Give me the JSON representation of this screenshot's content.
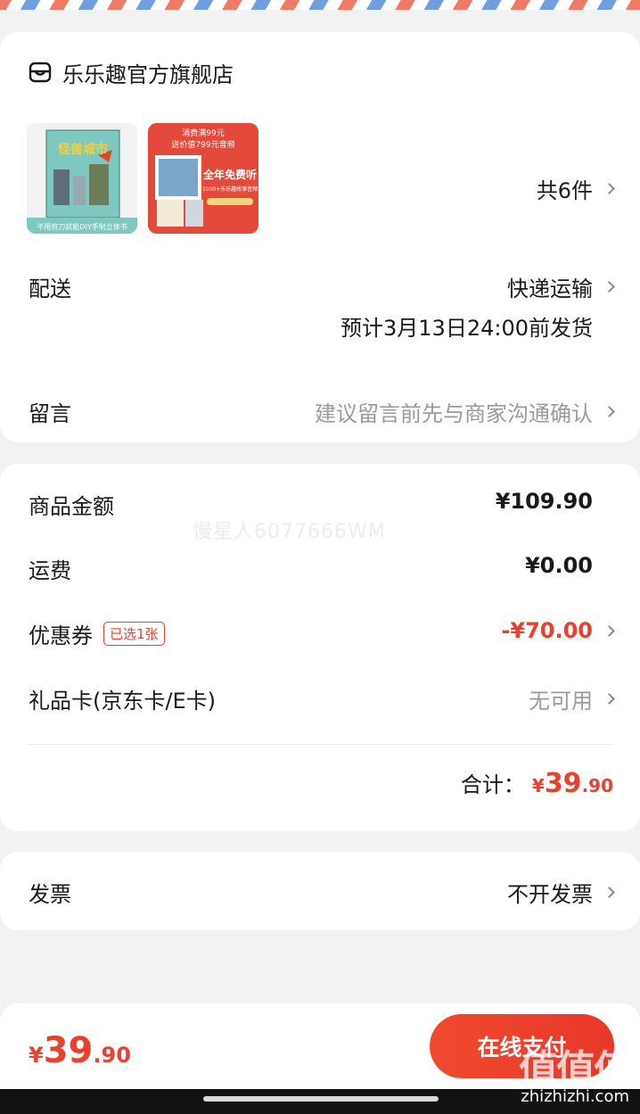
{
  "store": {
    "name": "乐乐趣官方旗舰店",
    "icon": "store-icon"
  },
  "products": {
    "item1": {
      "title": "怪兽城市",
      "caption": "不用剪刀就能DIY手制立体书"
    },
    "item2": {
      "line1": "消费满99元",
      "line2": "送价值799元音频",
      "headline": "全年免费听",
      "sub": "1000+乐乐趣故事音频"
    },
    "count_label": "共6件"
  },
  "delivery": {
    "label": "配送",
    "method": "快递运输",
    "eta": "预计3月13日24:00前发货"
  },
  "message": {
    "label": "留言",
    "placeholder": "建议留言前先与商家沟通确认"
  },
  "pricing": {
    "goods_label": "商品金额",
    "goods_value": "¥109.90",
    "shipping_label": "运费",
    "shipping_value": "¥0.00",
    "coupon_label": "优惠券",
    "coupon_badge": "已选1张",
    "coupon_value": "-¥70.00",
    "giftcard_label": "礼品卡(京东卡/E卡)",
    "giftcard_value": "无可用",
    "total_label": "合计：",
    "total_symbol": "¥",
    "total_int": "39",
    "total_dec": ".90"
  },
  "watermark": "慢星人6077666WM",
  "invoice": {
    "label": "发票",
    "value": "不开发票"
  },
  "bottom": {
    "symbol": "¥",
    "int": "39",
    "dec": ".90",
    "pay_label": "在线支付"
  },
  "overlay": {
    "brand": "值值值",
    "site": "zhizhizhi.com"
  },
  "colors": {
    "accent": "#e8412d",
    "muted": "#9b9b9b"
  }
}
